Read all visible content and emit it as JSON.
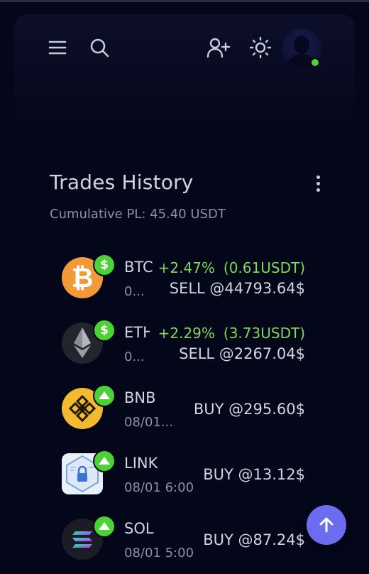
{
  "header": {
    "menu_icon": "hamburger-menu-icon",
    "search_icon": "search-icon",
    "add_user_icon": "user-plus-icon",
    "theme_icon": "sun-icon",
    "avatar_status": "online"
  },
  "trades": {
    "title": "Trades History",
    "summary": "Cumulative PL: 45.40 USDT",
    "items": [
      {
        "symbol": "BTC",
        "symbol_visible": "BTC",
        "time": "0...",
        "badge": "$",
        "pl_percent": "+2.47%",
        "pl_amount": "(0.61USDT)",
        "order": "SELL @44793.64$",
        "icon": "bitcoin-icon"
      },
      {
        "symbol": "ETH",
        "symbol_visible": "ETH",
        "time": "0...",
        "badge": "$",
        "pl_percent": "+2.29%",
        "pl_amount": "(3.73USDT)",
        "order": "SELL @2267.04$",
        "icon": "ethereum-icon"
      },
      {
        "symbol": "BNB",
        "time": "08/01...",
        "badge": "up",
        "order": "BUY @295.60$",
        "icon": "bnb-icon"
      },
      {
        "symbol": "LINK",
        "time": "08/01 6:00",
        "badge": "up",
        "order": "BUY @13.12$",
        "icon": "chainlink-icon"
      },
      {
        "symbol": "SOL",
        "time": "08/01 5:00",
        "badge": "up",
        "order": "BUY @87.24$",
        "icon": "solana-icon"
      }
    ]
  },
  "colors": {
    "background": "#04061a",
    "profit_green": "#7ed957",
    "badge_green": "#4cd137",
    "fab": "#6c6cf0"
  },
  "fab_icon": "arrow-up-icon"
}
